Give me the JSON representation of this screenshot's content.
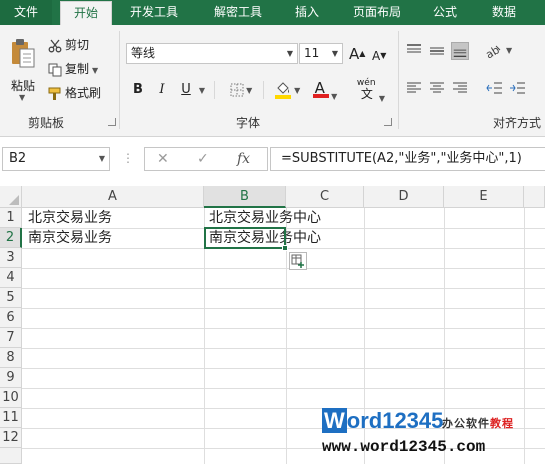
{
  "tabs": [
    "文件",
    "开始",
    "开发工具",
    "解密工具",
    "插入",
    "页面布局",
    "公式",
    "数据"
  ],
  "active_tab": "开始",
  "clipboard": {
    "paste_label": "粘贴",
    "cut_label": "剪切",
    "copy_label": "复制",
    "format_painter_label": "格式刷",
    "group_label": "剪贴板"
  },
  "font": {
    "name": "等线",
    "size": "11",
    "bold": "B",
    "italic": "I",
    "underline": "U",
    "grow": "A",
    "shrink": "A",
    "phonetic_top": "wén",
    "phonetic_bottom": "文",
    "font_color_letter": "A",
    "group_label": "字体"
  },
  "alignment": {
    "group_label": "对齐方式"
  },
  "colors": {
    "accent": "#217346",
    "font_color_bar": "#e02020",
    "fill_color_bar": "#ffd800"
  },
  "formula_bar": {
    "name_box": "B2",
    "cancel": "✕",
    "enter": "✓",
    "fx": "fx",
    "formula": "=SUBSTITUTE(A2,\"业务\",\"业务中心\",1)"
  },
  "columns": [
    "A",
    "B",
    "C",
    "D",
    "E"
  ],
  "rows": [
    "1",
    "2",
    "3",
    "4",
    "5",
    "6",
    "7",
    "8",
    "9",
    "10",
    "11",
    "12"
  ],
  "cells": {
    "A1": "北京交易业务",
    "A2": "南京交易业务",
    "B1": "北京交易业务中心",
    "B2": "南京交易业务中心"
  },
  "watermark": {
    "logo_w": "W",
    "logo_rest": "ord12345",
    "caption_main": "办公软件",
    "caption_red": "教程",
    "url": "www.word12345.com"
  }
}
